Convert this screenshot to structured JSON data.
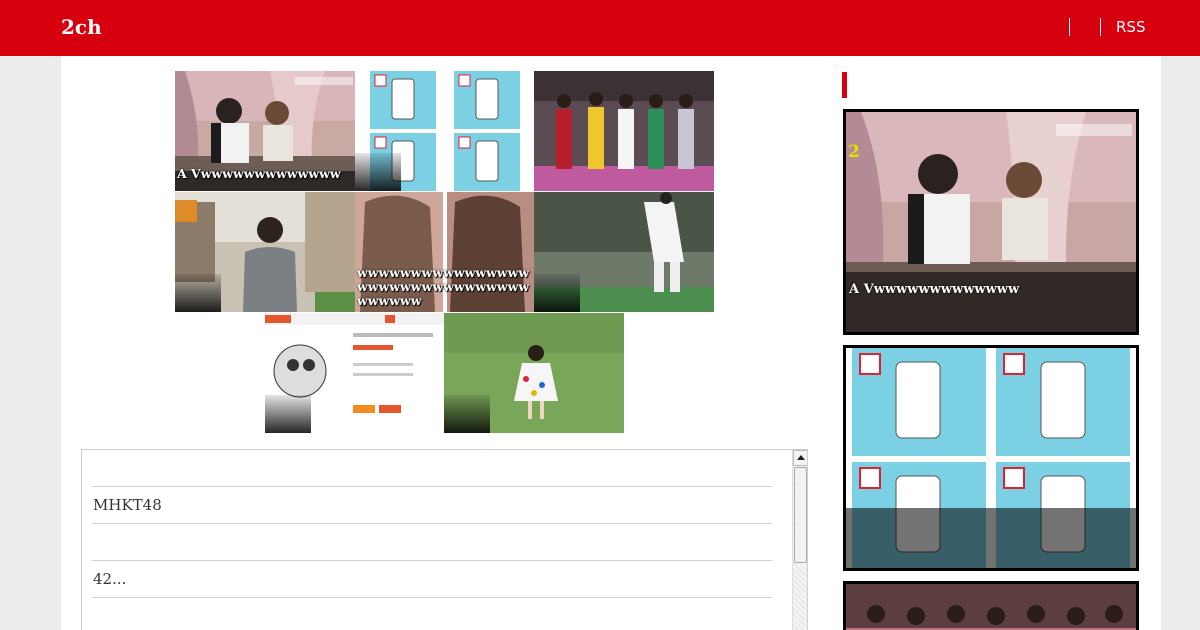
{
  "header": {
    "brand": "2ch",
    "rss_label": "RSS"
  },
  "thumbnails": [
    {
      "id": "t1",
      "caption": "A Vwwwwwwwwwwwww",
      "scene": "two-people-on-sofa"
    },
    {
      "id": "t2",
      "caption": "",
      "scene": "phone-grip-grid"
    },
    {
      "id": "t3",
      "caption": "",
      "scene": "idol-group"
    },
    {
      "id": "t4",
      "caption": "",
      "scene": "street-woman"
    },
    {
      "id": "t5",
      "caption": "wwwwwwwwwwwwwwwwwwwwwwwwwwwwwwwwwwwwww",
      "scene": "long-hair"
    },
    {
      "id": "t6",
      "caption": "",
      "scene": "baseball-pitch"
    },
    {
      "id": "t7",
      "caption": "",
      "scene": "shop-page-hoodie"
    },
    {
      "id": "t8",
      "caption": "",
      "scene": "girl-on-field"
    }
  ],
  "list": {
    "rows": [
      {
        "text": ""
      },
      {
        "text": "MHKT48"
      },
      {
        "text": ""
      },
      {
        "text": "42..."
      },
      {
        "text": ""
      }
    ]
  },
  "sidebar": {
    "title": "",
    "cards": [
      {
        "caption": "A Vwwwwwwwwwwwww",
        "rank": "2"
      },
      {
        "caption": "",
        "rank": ""
      },
      {
        "caption": "",
        "rank": ""
      }
    ]
  },
  "colors": {
    "brand_red": "#d7000f",
    "panel": "#ffffff",
    "page_bg": "#ececec"
  }
}
